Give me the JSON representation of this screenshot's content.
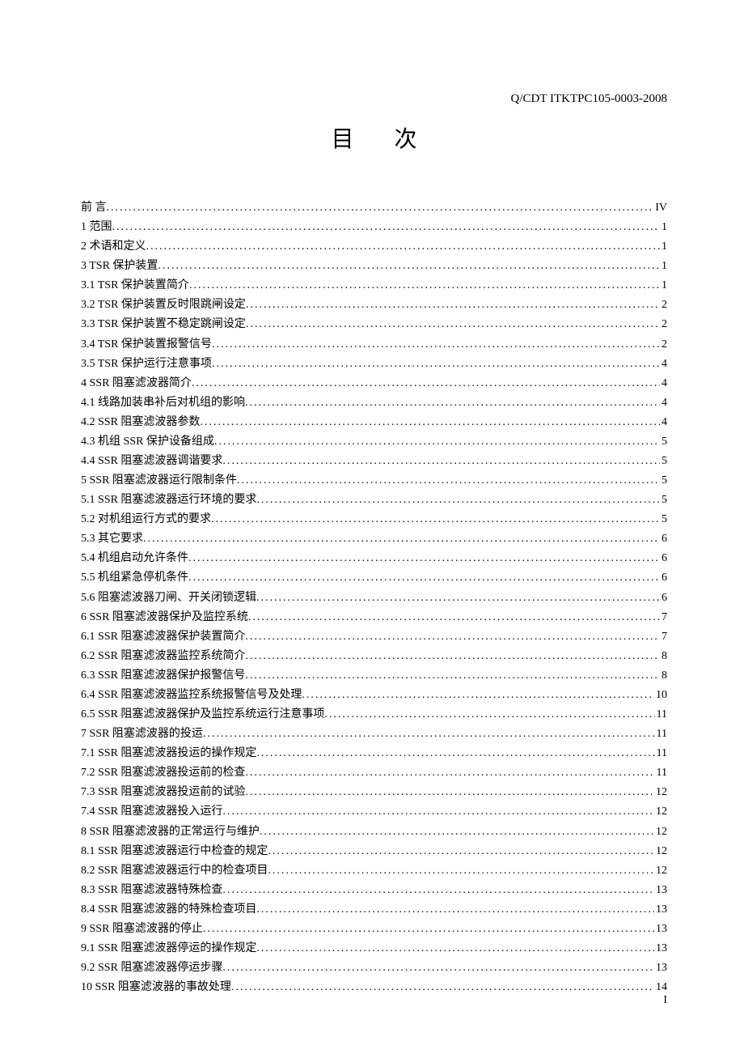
{
  "header_code": "Q/CDT ITKTPC105-0003-2008",
  "title": "目次",
  "page_number": "I",
  "toc": [
    {
      "label": "前     言",
      "page": "IV"
    },
    {
      "label": "1 范围",
      "page": "1"
    },
    {
      "label": "2 术语和定义",
      "page": "1"
    },
    {
      "label": "3 TSR 保护装置",
      "page": "1"
    },
    {
      "label": "3.1 TSR 保护装置简介",
      "page": "1"
    },
    {
      "label": "3.2 TSR 保护装置反时限跳闸设定",
      "page": "2"
    },
    {
      "label": "3.3 TSR 保护装置不稳定跳闸设定",
      "page": "2"
    },
    {
      "label": "3.4 TSR 保护装置报警信号",
      "page": "2"
    },
    {
      "label": "3.5 TSR 保护运行注意事项",
      "page": "4"
    },
    {
      "label": "4 SSR 阻塞滤波器简介",
      "page": "4"
    },
    {
      "label": "4.1 线路加装串补后对机组的影响",
      "page": "4"
    },
    {
      "label": "4.2 SSR 阻塞滤波器参数",
      "page": "4"
    },
    {
      "label": "4.3 机组 SSR 保护设备组成",
      "page": "5"
    },
    {
      "label": "4.4 SSR 阻塞滤波器调谐要求",
      "page": "5"
    },
    {
      "label": "5 SSR 阻塞滤波器运行限制条件",
      "page": "5"
    },
    {
      "label": "5.1 SSR 阻塞滤波器运行环境的要求",
      "page": "5"
    },
    {
      "label": "5.2 对机组运行方式的要求",
      "page": "5"
    },
    {
      "label": "5.3 其它要求",
      "page": "6"
    },
    {
      "label": "5.4 机组启动允许条件",
      "page": "6"
    },
    {
      "label": "5.5 机组紧急停机条件",
      "page": "6"
    },
    {
      "label": "5.6 阻塞滤波器刀闸、开关闭锁逻辑",
      "page": "6"
    },
    {
      "label": "6 SSR 阻塞滤波器保护及监控系统",
      "page": "7"
    },
    {
      "label": "6.1 SSR 阻塞滤波器保护装置简介",
      "page": "7"
    },
    {
      "label": "6.2 SSR 阻塞滤波器监控系统简介",
      "page": "8"
    },
    {
      "label": "6.3 SSR 阻塞滤波器保护报警信号",
      "page": "8"
    },
    {
      "label": "6.4 SSR 阻塞滤波器监控系统报警信号及处理",
      "page": "10"
    },
    {
      "label": "6.5 SSR 阻塞滤波器保护及监控系统运行注意事项",
      "page": "11"
    },
    {
      "label": "7 SSR 阻塞滤波器的投运",
      "page": "11"
    },
    {
      "label": "7.1 SSR 阻塞滤波器投运的操作规定",
      "page": "11"
    },
    {
      "label": "7.2 SSR 阻塞滤波器投运前的检查",
      "page": "11"
    },
    {
      "label": "7.3 SSR 阻塞滤波器投运前的试验",
      "page": "12"
    },
    {
      "label": "7.4 SSR 阻塞滤波器投入运行",
      "page": "12"
    },
    {
      "label": "8 SSR 阻塞滤波器的正常运行与维护",
      "page": "12"
    },
    {
      "label": "8.1 SSR 阻塞滤波器运行中检查的规定",
      "page": "12"
    },
    {
      "label": "8.2 SSR 阻塞滤波器运行中的检查项目",
      "page": "12"
    },
    {
      "label": "8.3 SSR 阻塞滤波器特殊检查",
      "page": "13"
    },
    {
      "label": "8.4 SSR 阻塞滤波器的特殊检查项目",
      "page": "13"
    },
    {
      "label": "9 SSR 阻塞滤波器的停止",
      "page": "13"
    },
    {
      "label": "9.1 SSR 阻塞滤波器停运的操作规定",
      "page": "13"
    },
    {
      "label": "9.2 SSR 阻塞滤波器停运步骤",
      "page": "13"
    },
    {
      "label": "10 SSR 阻塞滤波器的事故处理",
      "page": "14"
    }
  ]
}
